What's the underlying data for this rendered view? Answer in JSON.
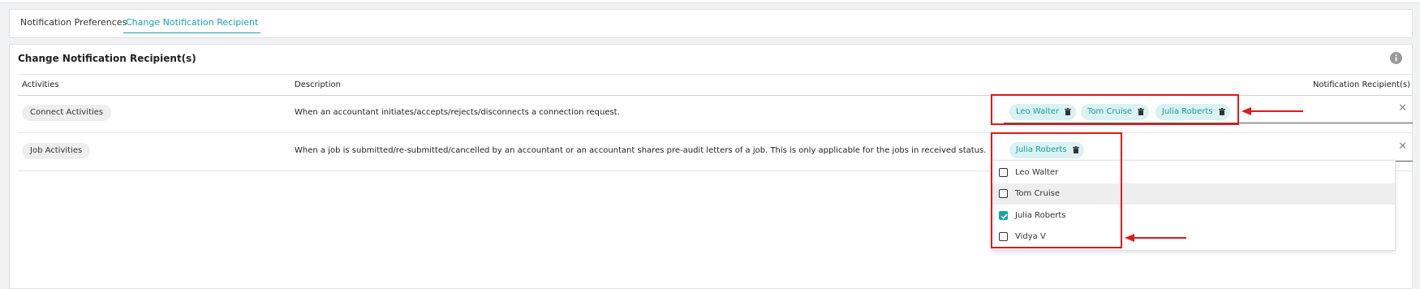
{
  "tabs": [
    {
      "label": "Notification Preferences",
      "active": false
    },
    {
      "label": "Change Notification Recipient",
      "active": true
    }
  ],
  "card": {
    "title": "Change Notification Recipient(s)",
    "info_icon": "info-icon"
  },
  "table": {
    "headers": {
      "activities": "Activities",
      "description": "Description",
      "recipients": "Notification Recipient(s)"
    },
    "rows": [
      {
        "activity": "Connect Activities",
        "description": "When an accountant initiates/accepts/rejects/disconnects a connection request.",
        "recipients": [
          "Leo Walter",
          "Tom Cruise",
          "Julia Roberts"
        ]
      },
      {
        "activity": "Job Activities",
        "description": "When a job is submitted/re-submitted/cancelled by an accountant or an accountant shares pre-audit letters of a job. This is only applicable for the jobs in received status.",
        "recipients": [
          "Julia Roberts"
        ]
      }
    ]
  },
  "dropdown": {
    "options": [
      {
        "label": "Leo Walter",
        "checked": false
      },
      {
        "label": "Tom Cruise",
        "checked": false
      },
      {
        "label": "Julia Roberts",
        "checked": true
      },
      {
        "label": "Vidya V",
        "checked": false
      }
    ]
  },
  "icons": {
    "chip_delete": "trash-icon",
    "clear": "close-icon",
    "checkbox_checked": "check-icon"
  },
  "colors": {
    "accent": "#1aa3a8",
    "chip_bg": "#d9f2f2",
    "annotation": "#e0191c"
  }
}
